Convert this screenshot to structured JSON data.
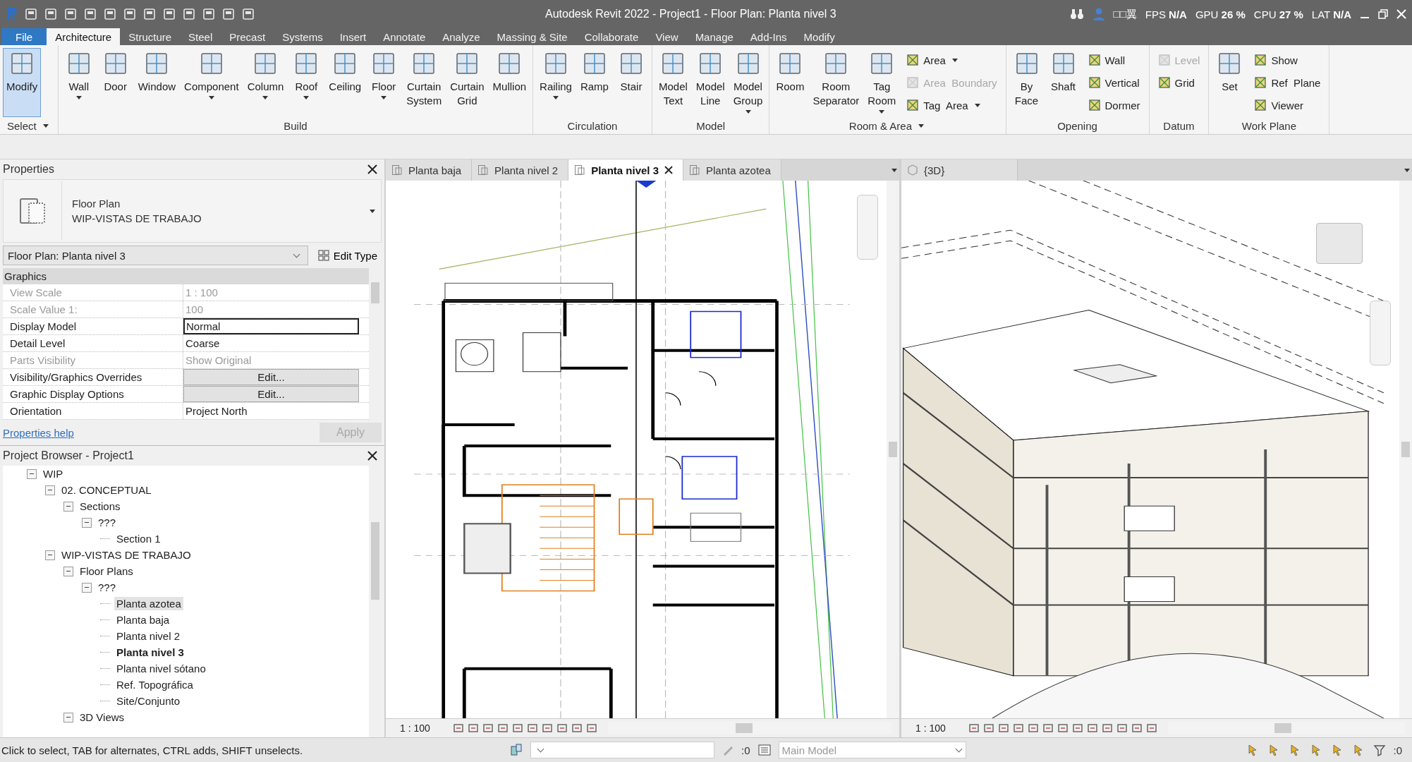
{
  "title_bar": {
    "title": "Autodesk Revit 2022 - Project1 - Floor Plan: Planta nivel 3",
    "user": "□□翼",
    "stats": [
      {
        "label": "FPS",
        "value": "N/A"
      },
      {
        "label": "GPU",
        "value": "26 %"
      },
      {
        "label": "CPU",
        "value": "27 %"
      },
      {
        "label": "LAT",
        "value": "N/A"
      }
    ]
  },
  "ribbon_tabs": [
    {
      "label": "File",
      "kind": "file",
      "selected": false
    },
    {
      "label": "Architecture",
      "kind": "tab",
      "selected": true
    },
    {
      "label": "Structure",
      "kind": "tab",
      "selected": false
    },
    {
      "label": "Steel",
      "kind": "tab",
      "selected": false
    },
    {
      "label": "Precast",
      "kind": "tab",
      "selected": false
    },
    {
      "label": "Systems",
      "kind": "tab",
      "selected": false
    },
    {
      "label": "Insert",
      "kind": "tab",
      "selected": false
    },
    {
      "label": "Annotate",
      "kind": "tab",
      "selected": false
    },
    {
      "label": "Analyze",
      "kind": "tab",
      "selected": false
    },
    {
      "label": "Massing & Site",
      "kind": "tab",
      "selected": false
    },
    {
      "label": "Collaborate",
      "kind": "tab",
      "selected": false
    },
    {
      "label": "View",
      "kind": "tab",
      "selected": false
    },
    {
      "label": "Manage",
      "kind": "tab",
      "selected": false
    },
    {
      "label": "Add-Ins",
      "kind": "tab",
      "selected": false
    },
    {
      "label": "Modify",
      "kind": "tab",
      "selected": false
    }
  ],
  "ribbon_panels": [
    {
      "title": "Select",
      "dropdown": true,
      "tools": [
        {
          "label": "Modify",
          "kind": "large",
          "selected": true
        }
      ]
    },
    {
      "title": "Build",
      "dropdown": false,
      "tools": [
        {
          "label": "Wall",
          "kind": "large",
          "dropdown": true
        },
        {
          "label": "Door",
          "kind": "large"
        },
        {
          "label": "Window",
          "kind": "large"
        },
        {
          "label": "Component",
          "kind": "large",
          "dropdown": true
        },
        {
          "label": "Column",
          "kind": "large",
          "dropdown": true
        },
        {
          "label": "Roof",
          "kind": "large",
          "dropdown": true
        },
        {
          "label": "Ceiling",
          "kind": "large"
        },
        {
          "label": "Floor",
          "kind": "large",
          "dropdown": true
        },
        {
          "label": "Curtain\nSystem",
          "kind": "large"
        },
        {
          "label": "Curtain\nGrid",
          "kind": "large"
        },
        {
          "label": "Mullion",
          "kind": "large"
        }
      ]
    },
    {
      "title": "Circulation",
      "dropdown": false,
      "tools": [
        {
          "label": "Railing",
          "kind": "large",
          "dropdown": true
        },
        {
          "label": "Ramp",
          "kind": "large"
        },
        {
          "label": "Stair",
          "kind": "large"
        }
      ]
    },
    {
      "title": "Model",
      "dropdown": false,
      "tools": [
        {
          "label": "Model\nText",
          "kind": "large"
        },
        {
          "label": "Model\nLine",
          "kind": "large"
        },
        {
          "label": "Model\nGroup",
          "kind": "large",
          "dropdown": true
        }
      ]
    },
    {
      "title": "Room & Area",
      "dropdown": true,
      "tools": [
        {
          "label": "Room",
          "kind": "large"
        },
        {
          "label": "Room\nSeparator",
          "kind": "large"
        },
        {
          "label": "Tag\nRoom",
          "kind": "large",
          "dropdown": true
        },
        {
          "label": "Area",
          "kind": "small",
          "dropdown": true,
          "disabled": false
        },
        {
          "label": "Area  Boundary",
          "kind": "small",
          "disabled": true
        },
        {
          "label": "Tag  Area",
          "kind": "small",
          "dropdown": true,
          "disabled": false
        }
      ]
    },
    {
      "title": "Opening",
      "dropdown": false,
      "tools": [
        {
          "label": "By\nFace",
          "kind": "large"
        },
        {
          "label": "Shaft",
          "kind": "large"
        },
        {
          "label": "Wall",
          "kind": "small",
          "disabled": false
        },
        {
          "label": "Vertical",
          "kind": "small",
          "disabled": false
        },
        {
          "label": "Dormer",
          "kind": "small",
          "disabled": false
        }
      ]
    },
    {
      "title": "Datum",
      "dropdown": false,
      "tools": [
        {
          "label": "Level",
          "kind": "small",
          "disabled": true
        },
        {
          "label": "Grid",
          "kind": "small",
          "disabled": false
        }
      ]
    },
    {
      "title": "Work Plane",
      "dropdown": false,
      "tools": [
        {
          "label": "Set",
          "kind": "large"
        },
        {
          "label": "Show",
          "kind": "small",
          "disabled": false
        },
        {
          "label": "Ref  Plane",
          "kind": "small",
          "disabled": false
        },
        {
          "label": "Viewer",
          "kind": "small",
          "disabled": false
        }
      ]
    }
  ],
  "properties": {
    "title": "Properties",
    "type_name": "Floor Plan",
    "type_family": "WIP-VISTAS DE TRABAJO",
    "instance": "Floor Plan: Planta nivel 3",
    "edit_type": "Edit Type",
    "group": "Graphics",
    "rows": [
      {
        "name": "View Scale",
        "value": "1 : 100",
        "kind": "readonly"
      },
      {
        "name": "Scale Value    1:",
        "value": "100",
        "kind": "readonly"
      },
      {
        "name": "Display Model",
        "value": "Normal",
        "kind": "field"
      },
      {
        "name": "Detail Level",
        "value": "Coarse",
        "kind": "text"
      },
      {
        "name": "Parts Visibility",
        "value": "Show Original",
        "kind": "readonly"
      },
      {
        "name": "Visibility/Graphics Overrides",
        "value": "Edit...",
        "kind": "button"
      },
      {
        "name": "Graphic Display Options",
        "value": "Edit...",
        "kind": "button"
      },
      {
        "name": "Orientation",
        "value": "Project North",
        "kind": "text"
      }
    ],
    "help_link": "Properties help",
    "apply": {
      "label": "Apply",
      "disabled": true
    }
  },
  "project_browser": {
    "title": "Project Browser - Project1",
    "tree": [
      {
        "label": "WIP",
        "expanded": true,
        "children": [
          {
            "label": "02. CONCEPTUAL",
            "expanded": true,
            "children": [
              {
                "label": "Sections",
                "expanded": true,
                "children": [
                  {
                    "label": "???",
                    "expanded": true,
                    "children": [
                      {
                        "label": "Section 1",
                        "selected": false,
                        "current": false
                      }
                    ]
                  }
                ]
              }
            ]
          },
          {
            "label": "WIP-VISTAS DE TRABAJO",
            "expanded": true,
            "children": [
              {
                "label": "Floor Plans",
                "expanded": true,
                "children": [
                  {
                    "label": "???",
                    "expanded": true,
                    "children": [
                      {
                        "label": "Planta azotea",
                        "selected": true,
                        "current": false
                      },
                      {
                        "label": "Planta baja",
                        "selected": false,
                        "current": false
                      },
                      {
                        "label": "Planta nivel 2",
                        "selected": false,
                        "current": false
                      },
                      {
                        "label": "Planta nivel 3",
                        "selected": false,
                        "current": true
                      },
                      {
                        "label": "Planta nivel sótano",
                        "selected": false,
                        "current": false
                      },
                      {
                        "label": "Ref. Topográfica",
                        "selected": false,
                        "current": false
                      },
                      {
                        "label": "Site/Conjunto",
                        "selected": false,
                        "current": false
                      }
                    ]
                  }
                ]
              },
              {
                "label": "3D Views",
                "expanded": true
              }
            ]
          }
        ]
      }
    ]
  },
  "plan_view": {
    "tabs": [
      {
        "label": "Planta baja",
        "selected": false
      },
      {
        "label": "Planta nivel 2",
        "selected": false
      },
      {
        "label": "Planta nivel 3",
        "selected": true
      },
      {
        "label": "Planta azotea",
        "selected": false
      }
    ],
    "scale": "1 : 100"
  },
  "view_3d": {
    "tabs": [
      {
        "label": "{3D}",
        "selected": false
      }
    ],
    "scale": "1 : 100"
  },
  "status_bar": {
    "message": "Click to select, TAB for alternates, CTRL adds, SHIFT unselects.",
    "workset_count": ":0",
    "design_option": "Main Model",
    "filter_count": ":0"
  }
}
